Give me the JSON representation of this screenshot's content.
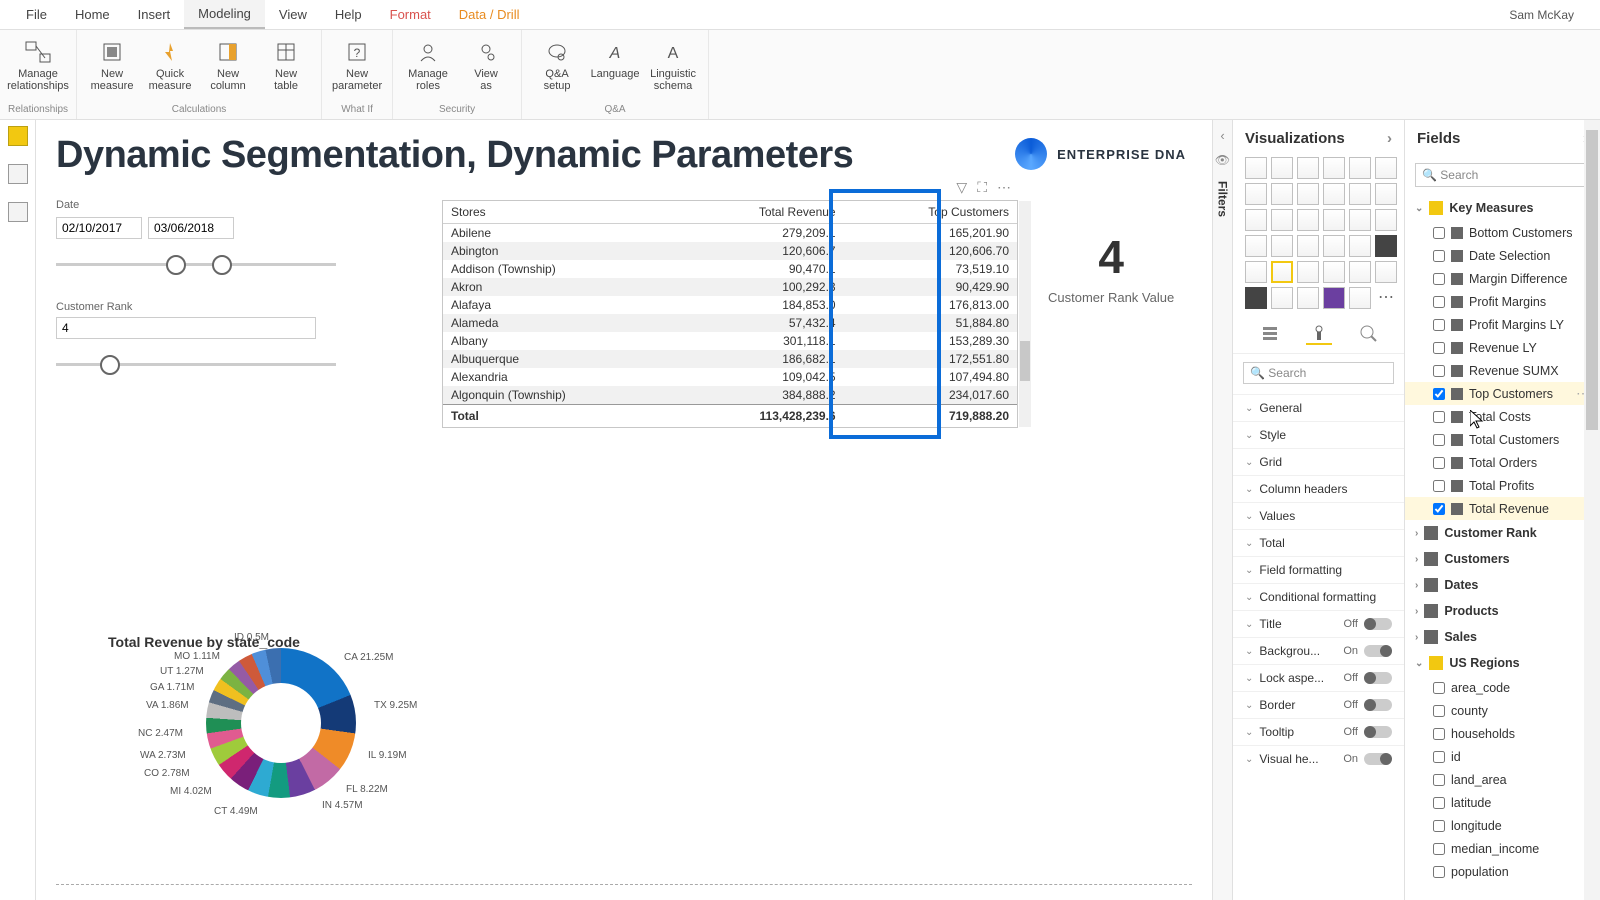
{
  "user": "Sam McKay",
  "menu": {
    "file": "File",
    "home": "Home",
    "insert": "Insert",
    "modeling": "Modeling",
    "view": "View",
    "help": "Help",
    "format": "Format",
    "drill": "Data / Drill"
  },
  "ribbon": {
    "relationships": {
      "manage": "Manage\nrelationships",
      "group": "Relationships"
    },
    "calc": {
      "newm": "New\nmeasure",
      "quick": "Quick\nmeasure",
      "newc": "New\ncolumn",
      "newt": "New\ntable",
      "group": "Calculations"
    },
    "whatif": {
      "param": "New\nparameter",
      "group": "What If"
    },
    "security": {
      "roles": "Manage\nroles",
      "viewas": "View\nas",
      "group": "Security"
    },
    "qa": {
      "setup": "Q&A\nsetup",
      "lang": "Language",
      "ling": "Linguistic\nschema",
      "group": "Q&A"
    }
  },
  "title": "Dynamic Segmentation, Dynamic Parameters",
  "brand": "ENTERPRISE DNA",
  "date": {
    "label": "Date",
    "from": "02/10/2017",
    "to": "03/06/2018"
  },
  "rank": {
    "label": "Customer Rank",
    "value": "4"
  },
  "card": {
    "value": "4",
    "label": "Customer Rank Value"
  },
  "table": {
    "cols": [
      "Stores",
      "Total Revenue",
      "Top Customers"
    ],
    "rows": [
      [
        "Abilene",
        "279,209.1",
        "165,201.90"
      ],
      [
        "Abington",
        "120,606.7",
        "120,606.70"
      ],
      [
        "Addison (Township)",
        "90,470.1",
        "73,519.10"
      ],
      [
        "Akron",
        "100,292.3",
        "90,429.90"
      ],
      [
        "Alafaya",
        "184,853.0",
        "176,813.00"
      ],
      [
        "Alameda",
        "57,432.4",
        "51,884.80"
      ],
      [
        "Albany",
        "301,118.1",
        "153,289.30"
      ],
      [
        "Albuquerque",
        "186,682.1",
        "172,551.80"
      ],
      [
        "Alexandria",
        "109,042.5",
        "107,494.80"
      ],
      [
        "Algonquin (Township)",
        "384,888.2",
        "234,017.60"
      ]
    ],
    "total": [
      "Total",
      "113,428,239.6",
      "719,888.20"
    ]
  },
  "chart": {
    "title": "Total Revenue by state_code"
  },
  "chart_data": {
    "type": "pie",
    "title": "Total Revenue by state_code",
    "series": [
      {
        "name": "CA",
        "value": 21.25,
        "unit": "M"
      },
      {
        "name": "TX",
        "value": 9.25,
        "unit": "M"
      },
      {
        "name": "IL",
        "value": 9.19,
        "unit": "M"
      },
      {
        "name": "FL",
        "value": 8.22,
        "unit": "M"
      },
      {
        "name": "IN",
        "value": 4.57,
        "unit": "M"
      },
      {
        "name": "CT",
        "value": 4.49,
        "unit": "M"
      },
      {
        "name": "MI",
        "value": 4.02,
        "unit": "M"
      },
      {
        "name": "CO",
        "value": 2.78,
        "unit": "M"
      },
      {
        "name": "WA",
        "value": 2.73,
        "unit": "M"
      },
      {
        "name": "NC",
        "value": 2.47,
        "unit": "M"
      },
      {
        "name": "VA",
        "value": 1.86,
        "unit": "M"
      },
      {
        "name": "GA",
        "value": 1.71,
        "unit": "M"
      },
      {
        "name": "UT",
        "value": 1.27,
        "unit": "M"
      },
      {
        "name": "MO",
        "value": 1.11,
        "unit": "M"
      },
      {
        "name": "ID",
        "value": 0.5,
        "unit": "M"
      }
    ],
    "labels": [
      "CA 21.25M",
      "TX 9.25M",
      "IL 9.19M",
      "FL 8.22M",
      "IN 4.57M",
      "CT 4.49M",
      "MI 4.02M",
      "CO 2.78M",
      "WA 2.73M",
      "NC 2.47M",
      "VA 1.86M",
      "GA 1.71M",
      "UT 1.27M",
      "MO 1.11M",
      "ID 0.5M"
    ]
  },
  "viz": {
    "header": "Visualizations",
    "search": "Search",
    "props": [
      {
        "label": "General"
      },
      {
        "label": "Style"
      },
      {
        "label": "Grid"
      },
      {
        "label": "Column headers"
      },
      {
        "label": "Values"
      },
      {
        "label": "Total"
      },
      {
        "label": "Field formatting"
      },
      {
        "label": "Conditional formatting"
      },
      {
        "label": "Title",
        "toggle": "Off"
      },
      {
        "label": "Backgrou...",
        "toggle": "On"
      },
      {
        "label": "Lock aspe...",
        "toggle": "Off"
      },
      {
        "label": "Border",
        "toggle": "Off"
      },
      {
        "label": "Tooltip",
        "toggle": "Off"
      },
      {
        "label": "Visual he...",
        "toggle": "On"
      }
    ]
  },
  "fields": {
    "header": "Fields",
    "search": "Search",
    "tables": [
      {
        "name": "Key Measures",
        "expanded": true,
        "highlight": true,
        "items": [
          {
            "name": "Bottom Customers",
            "type": "m"
          },
          {
            "name": "Date Selection",
            "type": "m"
          },
          {
            "name": "Margin Difference",
            "type": "m"
          },
          {
            "name": "Profit Margins",
            "type": "m"
          },
          {
            "name": "Profit Margins LY",
            "type": "m"
          },
          {
            "name": "Revenue LY",
            "type": "m"
          },
          {
            "name": "Revenue SUMX",
            "type": "m"
          },
          {
            "name": "Top Customers",
            "type": "m",
            "checked": true,
            "hover": true
          },
          {
            "name": "Total Costs",
            "type": "m"
          },
          {
            "name": "Total Customers",
            "type": "m"
          },
          {
            "name": "Total Orders",
            "type": "m"
          },
          {
            "name": "Total Profits",
            "type": "m"
          },
          {
            "name": "Total Revenue",
            "type": "m",
            "checked": true
          }
        ]
      },
      {
        "name": "Customer Rank",
        "expanded": false,
        "icon": "t"
      },
      {
        "name": "Customers",
        "expanded": false,
        "icon": "t"
      },
      {
        "name": "Dates",
        "expanded": false,
        "icon": "t"
      },
      {
        "name": "Products",
        "expanded": false,
        "icon": "t"
      },
      {
        "name": "Sales",
        "expanded": false,
        "icon": "t"
      },
      {
        "name": "US Regions",
        "expanded": true,
        "highlight": true,
        "icon": "t",
        "items": [
          {
            "name": "area_code",
            "type": "c"
          },
          {
            "name": "county",
            "type": "c"
          },
          {
            "name": "households",
            "type": "c"
          },
          {
            "name": "id",
            "type": "c"
          },
          {
            "name": "land_area",
            "type": "c"
          },
          {
            "name": "latitude",
            "type": "c"
          },
          {
            "name": "longitude",
            "type": "c"
          },
          {
            "name": "median_income",
            "type": "c"
          },
          {
            "name": "population",
            "type": "c"
          }
        ]
      }
    ]
  },
  "filtersTab": "Filters"
}
